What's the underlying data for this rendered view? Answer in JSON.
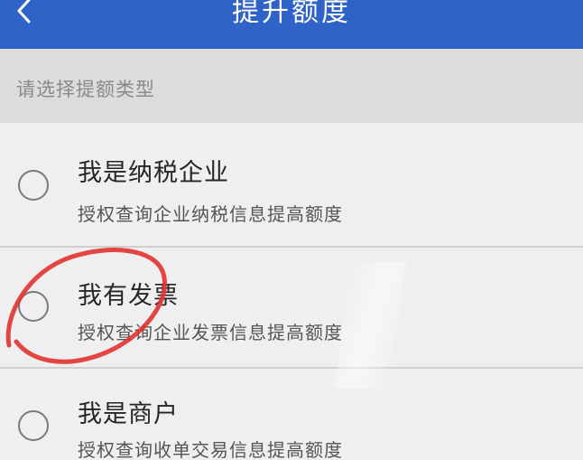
{
  "header": {
    "title": "提升额度",
    "back_icon": "chevron-left-icon",
    "color": "#2f63c8"
  },
  "section": {
    "label": "请选择提额类型"
  },
  "options": [
    {
      "title": "我是纳税企业",
      "description": "授权查询企业纳税信息提高额度",
      "selected": false
    },
    {
      "title": "我有发票",
      "description": "授权查询企业发票信息提高额度",
      "selected": false
    },
    {
      "title": "我是商户",
      "description": "授权查询收单交易信息提高额度",
      "selected": false
    }
  ],
  "annotation": {
    "type": "hand-drawn circle",
    "color": "#e0322f"
  }
}
